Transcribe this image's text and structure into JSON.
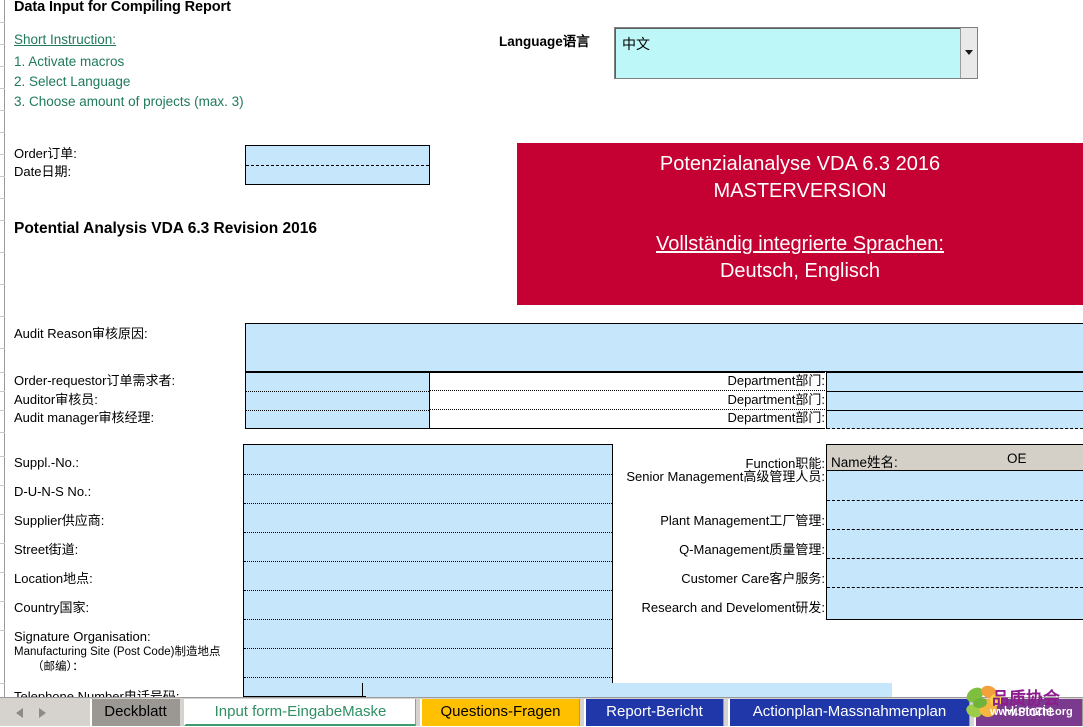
{
  "page": {
    "title": "Data Input for Compiling Report"
  },
  "instruction": {
    "heading": "Short Instruction:",
    "step1": "1. Activate macros",
    "step2": "2. Select Language",
    "step3": "3. Choose amount of projects (max. 3)"
  },
  "language": {
    "label": "Language语言",
    "selected": "中文",
    "dropdown_icon": "chevron-down-icon"
  },
  "order": {
    "order_label": "Order订单:",
    "date_label": "Date日期:",
    "order_value": "",
    "date_value": ""
  },
  "headings": {
    "potential_analysis": "Potential Analysis VDA 6.3 Revision 2016"
  },
  "banner": {
    "line1": "Potenzialanalyse  VDA 6.3 2016",
    "line2": "MASTERVERSION",
    "line3": "Vollständig integrierte Sprachen:",
    "line4": "Deutsch, Englisch",
    "background": "#c50032",
    "text_color": "#ffffff"
  },
  "audit": {
    "reason_label": "Audit Reason审核原因:",
    "reason_value": "",
    "rows": [
      {
        "label": "Order-requestor订单需求者:",
        "name_value": "",
        "dept_label": "Department部门:",
        "dept_value": ""
      },
      {
        "label": "Auditor审核员:",
        "name_value": "",
        "dept_label": "Department部门:",
        "dept_value": ""
      },
      {
        "label": "Audit manager审核经理:",
        "name_value": "",
        "dept_label": "Department部门:",
        "dept_value": ""
      }
    ]
  },
  "supplier": {
    "rows": [
      {
        "label": "Suppl.-No.:",
        "value": ""
      },
      {
        "label": " D-U-N-S No.:",
        "value": ""
      },
      {
        "label": "Supplier供应商:",
        "value": ""
      },
      {
        "label": "Street街道:",
        "value": ""
      },
      {
        "label": "Location地点:",
        "value": ""
      },
      {
        "label": "Country国家:",
        "value": ""
      },
      {
        "label": "Signature Organisation:",
        "value": ""
      },
      {
        "label": "Manufacturing Site (Post Code)制造地点",
        "label2": "（邮编）：",
        "value": ""
      }
    ],
    "telephone_label": "Telephone Number电话号码:"
  },
  "functions": {
    "header_function": "Function职能:",
    "header_name": "Name姓名:",
    "header_oe": "OE",
    "rows": [
      {
        "label": "Senior Management高级管理人员:",
        "name_value": "",
        "oe_value": ""
      },
      {
        "label": "Plant Management工厂管理:",
        "name_value": "",
        "oe_value": ""
      },
      {
        "label": "Q-Management质量管理:",
        "name_value": "",
        "oe_value": ""
      },
      {
        "label": "Customer Care客户服务:",
        "name_value": "",
        "oe_value": ""
      },
      {
        "label": "Research and Develoment研发:",
        "name_value": "",
        "oe_value": ""
      }
    ]
  },
  "tabs": {
    "nav_prev_icon": "arrow-left-icon",
    "nav_next_icon": "arrow-right-icon",
    "items": [
      {
        "label": "Deckblatt",
        "state": "gray"
      },
      {
        "label": "Input form-EingabeMaske",
        "state": "active"
      },
      {
        "label": "Questions-Fragen",
        "state": "yellow"
      },
      {
        "label": "Report-Bericht",
        "state": "blue"
      },
      {
        "label": "Actionplan-Massnahmenplan",
        "state": "blue"
      },
      {
        "label": "Historie",
        "state": "purple"
      }
    ]
  },
  "watermark": {
    "text": "品质协会",
    "url": "www.PinZhi.org"
  },
  "colors": {
    "input_blue": "#c5e6fb",
    "banner_red": "#c50032",
    "instruction_green": "#1f7a5a",
    "combo_cyan": "#bdf7f7",
    "header_gray": "#d4d0c8",
    "tab_yellow": "#ffc000",
    "tab_blue": "#1f37a8",
    "tab_purple": "#7a3b8f"
  }
}
